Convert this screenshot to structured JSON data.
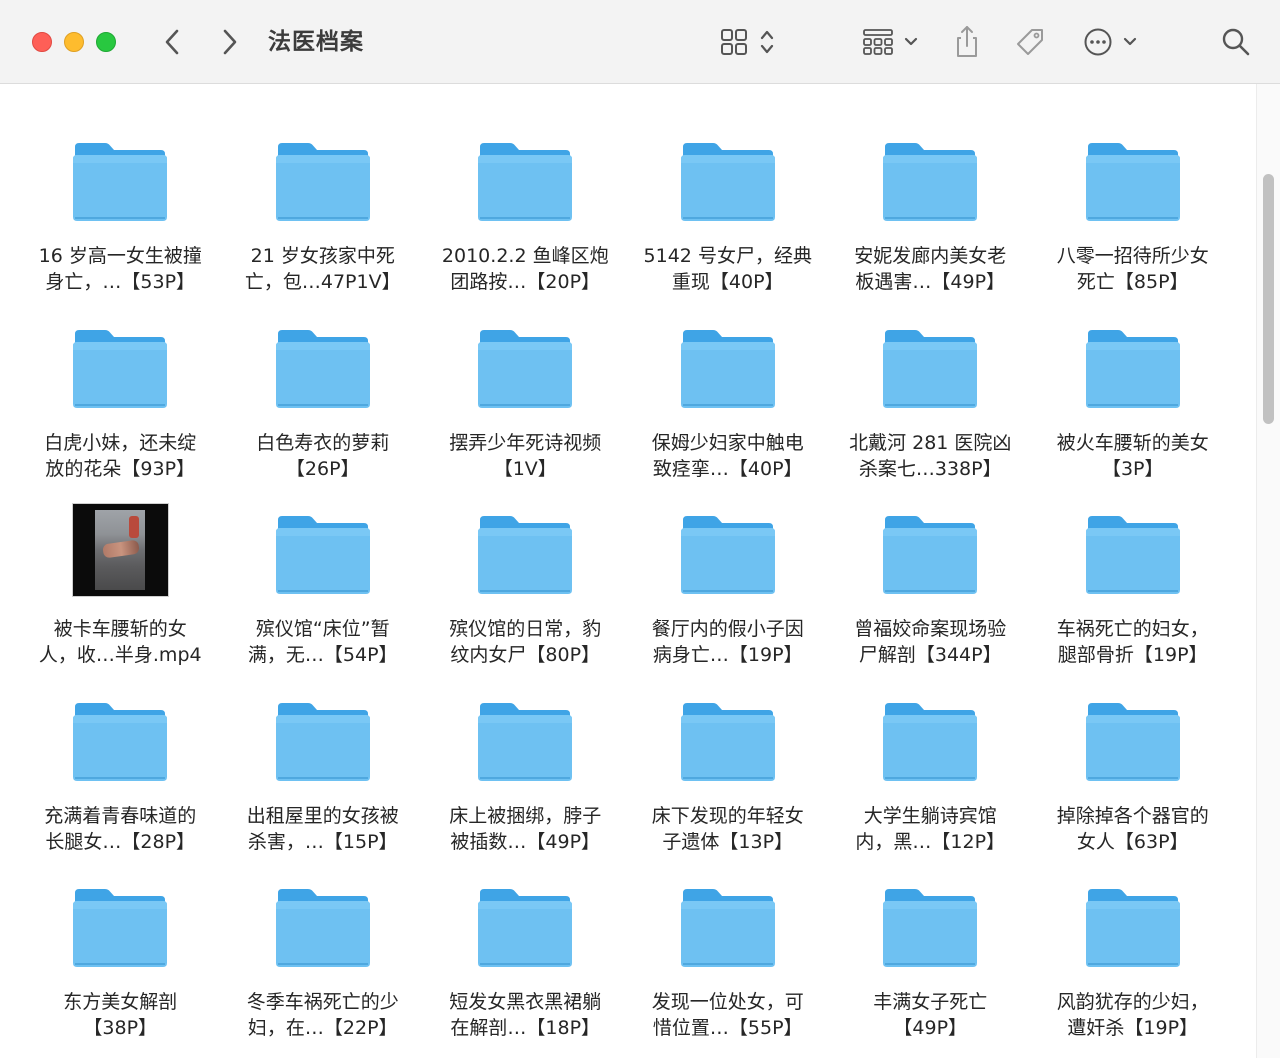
{
  "window": {
    "title": "法医档案"
  },
  "toolbar": {
    "buttons": [
      {
        "name": "back",
        "icon": "chevron-left-icon"
      },
      {
        "name": "forward",
        "icon": "chevron-right-icon"
      },
      {
        "name": "view-mode",
        "icon": "grid-view-icon"
      },
      {
        "name": "group",
        "icon": "group-by-icon"
      },
      {
        "name": "share",
        "icon": "share-icon"
      },
      {
        "name": "tags",
        "icon": "tag-icon"
      },
      {
        "name": "more",
        "icon": "ellipsis-circle-icon"
      },
      {
        "name": "search",
        "icon": "search-icon"
      }
    ]
  },
  "colors": {
    "folder_top": "#7ac8f5",
    "folder_body": "#6ec1f2",
    "folder_tab": "#3fa4e6",
    "close": "#fe5f57",
    "minimize": "#febc2e",
    "zoom": "#28c840"
  },
  "files": [
    {
      "label": "16 岁高一女生被撞\n身亡，…【53P】",
      "kind": "folder"
    },
    {
      "label": "21 岁女孩家中死\n亡，包…47P1V】",
      "kind": "folder"
    },
    {
      "label": "2010.2.2 鱼峰区炮\n团路按…【20P】",
      "kind": "folder"
    },
    {
      "label": "5142 号女尸，经典\n重现【40P】",
      "kind": "folder"
    },
    {
      "label": "安妮发廊内美女老\n板遇害…【49P】",
      "kind": "folder"
    },
    {
      "label": "八零一招待所少女\n死亡【85P】",
      "kind": "folder"
    },
    {
      "label": "白虎小妹，还未绽\n放的花朵【93P】",
      "kind": "folder"
    },
    {
      "label": "白色寿衣的萝莉\n【26P】",
      "kind": "folder"
    },
    {
      "label": "摆弄少年死诗视频\n【1V】",
      "kind": "folder"
    },
    {
      "label": "保姆少妇家中触电\n致痉挛…【40P】",
      "kind": "folder"
    },
    {
      "label": "北戴河 281 医院凶\n杀案七…338P】",
      "kind": "folder"
    },
    {
      "label": "被火车腰斩的美女\n【3P】",
      "kind": "folder"
    },
    {
      "label": "被卡车腰斩的女\n人，收…半身.mp4",
      "kind": "video"
    },
    {
      "label": "殡仪馆“床位”暂\n满，无…【54P】",
      "kind": "folder"
    },
    {
      "label": "殡仪馆的日常，豹\n纹内女尸【80P】",
      "kind": "folder"
    },
    {
      "label": "餐厅内的假小子因\n病身亡…【19P】",
      "kind": "folder"
    },
    {
      "label": "曾福姣命案现场验\n尸解剖【344P】",
      "kind": "folder"
    },
    {
      "label": "车祸死亡的妇女，\n腿部骨折【19P】",
      "kind": "folder"
    },
    {
      "label": "充满着青春味道的\n长腿女…【28P】",
      "kind": "folder"
    },
    {
      "label": "出租屋里的女孩被\n杀害，…【15P】",
      "kind": "folder"
    },
    {
      "label": "床上被捆绑，脖子\n被插数…【49P】",
      "kind": "folder"
    },
    {
      "label": "床下发现的年轻女\n子遗体【13P】",
      "kind": "folder"
    },
    {
      "label": "大学生躺诗宾馆\n内，黑…【12P】",
      "kind": "folder"
    },
    {
      "label": "掉除掉各个器官的\n女人【63P】",
      "kind": "folder"
    },
    {
      "label": "东方美女解剖\n【38P】",
      "kind": "folder"
    },
    {
      "label": "冬季车祸死亡的少\n妇，在…【22P】",
      "kind": "folder"
    },
    {
      "label": "短发女黑衣黑裙躺\n在解剖…【18P】",
      "kind": "folder"
    },
    {
      "label": "发现一位处女，可\n惜位置…【55P】",
      "kind": "folder"
    },
    {
      "label": "丰满女子死亡\n【49P】",
      "kind": "folder"
    },
    {
      "label": "风韵犹存的少妇，\n遭奸杀【19P】",
      "kind": "folder"
    }
  ]
}
